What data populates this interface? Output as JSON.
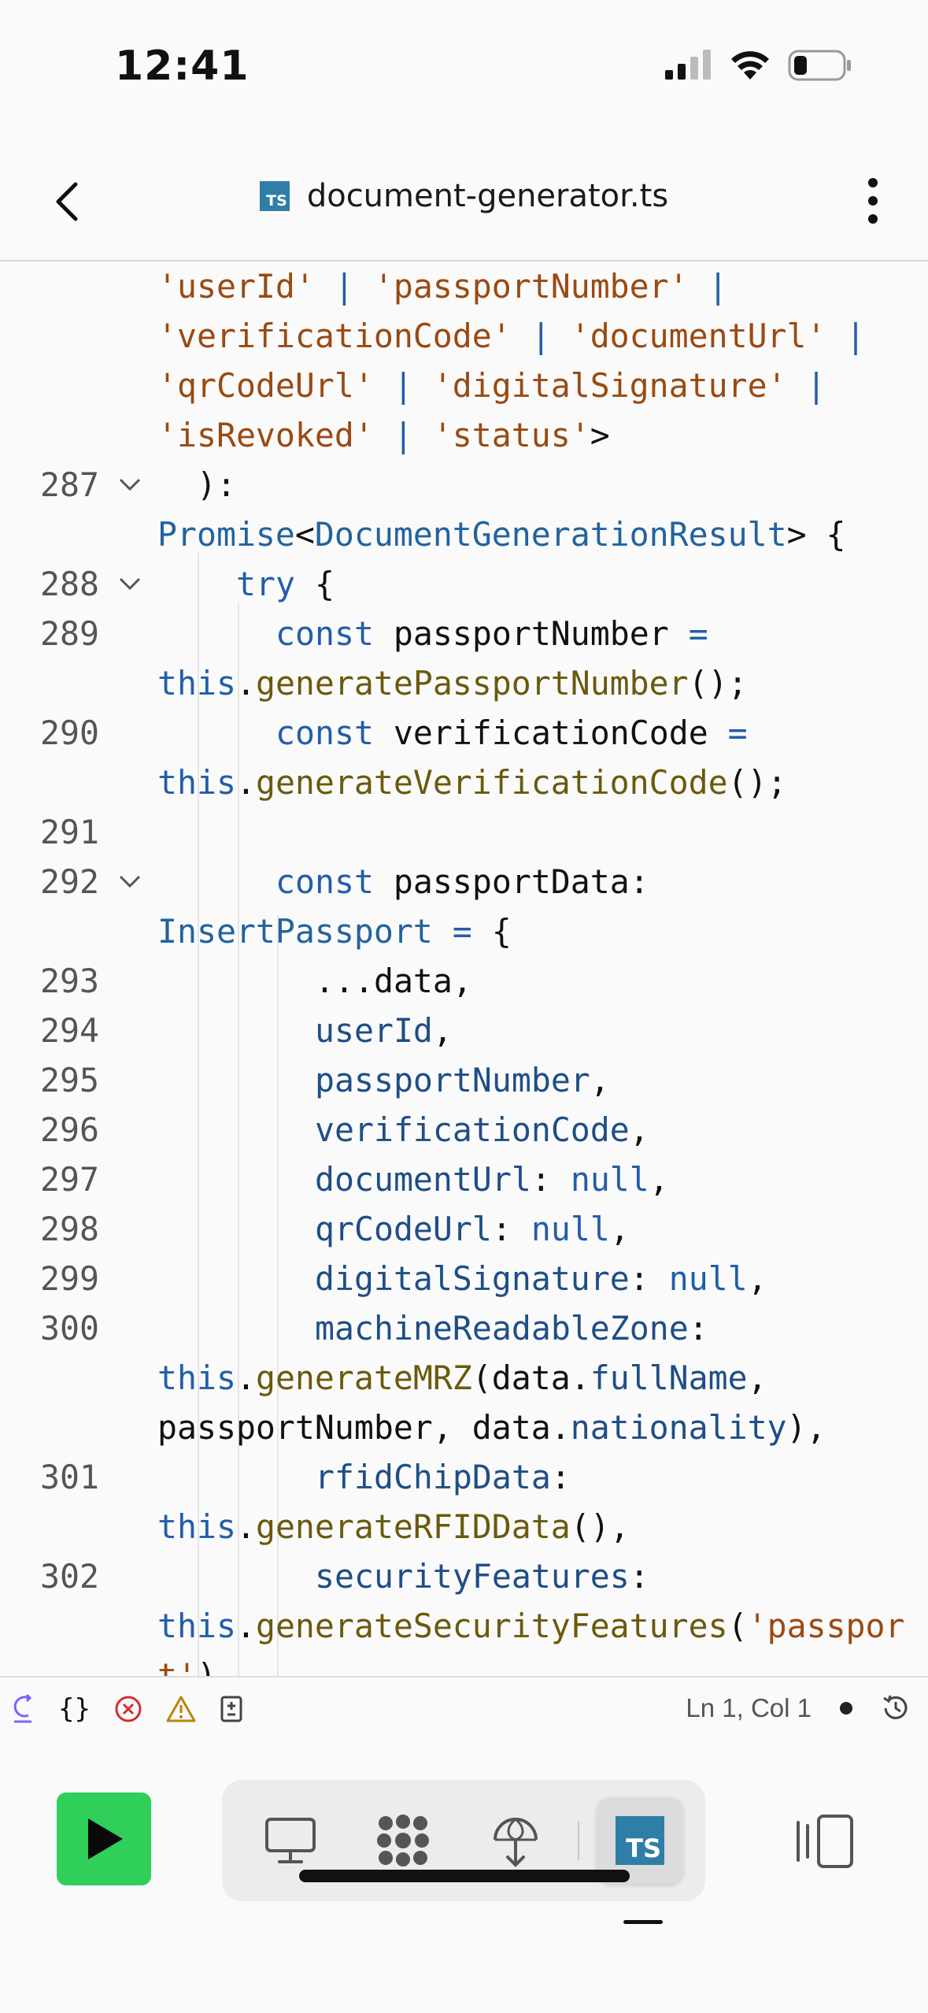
{
  "status_bar": {
    "time": "12:41"
  },
  "app_bar": {
    "file_badge": "TS",
    "file_name": "document-generator.ts"
  },
  "editor": {
    "lines": [
      {
        "num": "",
        "fold": false,
        "indent": 0,
        "tokens": [
          [
            "'userId'",
            "str"
          ],
          [
            " | ",
            "kw"
          ],
          [
            "'passportNumber'",
            "str"
          ],
          [
            " |",
            "kw"
          ]
        ]
      },
      {
        "num": "",
        "fold": false,
        "indent": 0,
        "tokens": [
          [
            "'verificationCode'",
            "str"
          ],
          [
            " | ",
            "kw"
          ],
          [
            "'documentUrl'",
            "str"
          ],
          [
            " |",
            "kw"
          ]
        ]
      },
      {
        "num": "",
        "fold": false,
        "indent": 0,
        "tokens": [
          [
            "'qrCodeUrl'",
            "str"
          ],
          [
            " | ",
            "kw"
          ],
          [
            "'digitalSignature'",
            "str"
          ],
          [
            " |",
            "kw"
          ]
        ]
      },
      {
        "num": "",
        "fold": false,
        "indent": 0,
        "tokens": [
          [
            "'isRevoked'",
            "str"
          ],
          [
            " | ",
            "kw"
          ],
          [
            "'status'",
            "str"
          ],
          [
            ">",
            "pl"
          ]
        ]
      },
      {
        "num": "287",
        "fold": true,
        "indent": 1,
        "tokens": [
          [
            "):",
            "pl"
          ]
        ]
      },
      {
        "num": "",
        "fold": false,
        "indent": 0,
        "tokens": [
          [
            "Promise",
            "ty"
          ],
          [
            "<",
            "pl"
          ],
          [
            "DocumentGenerationResult",
            "ty"
          ],
          [
            "> {",
            "pl"
          ]
        ]
      },
      {
        "num": "288",
        "fold": true,
        "indent": 2,
        "tokens": [
          [
            "try",
            "kw"
          ],
          [
            " {",
            "pl"
          ]
        ]
      },
      {
        "num": "289",
        "fold": false,
        "indent": 3,
        "tokens": [
          [
            "const",
            "kw"
          ],
          [
            " passportNumber ",
            "pl"
          ],
          [
            "=",
            "kw"
          ]
        ]
      },
      {
        "num": "",
        "fold": false,
        "indent": 0,
        "tokens": [
          [
            "this",
            "kw"
          ],
          [
            ".",
            "pl"
          ],
          [
            "generatePassportNumber",
            "fn"
          ],
          [
            "();",
            "pl"
          ]
        ]
      },
      {
        "num": "290",
        "fold": false,
        "indent": 3,
        "tokens": [
          [
            "const",
            "kw"
          ],
          [
            " verificationCode ",
            "pl"
          ],
          [
            "=",
            "kw"
          ]
        ]
      },
      {
        "num": "",
        "fold": false,
        "indent": 0,
        "tokens": [
          [
            "this",
            "kw"
          ],
          [
            ".",
            "pl"
          ],
          [
            "generateVerificationCode",
            "fn"
          ],
          [
            "();",
            "pl"
          ]
        ]
      },
      {
        "num": "291",
        "fold": false,
        "indent": 0,
        "tokens": []
      },
      {
        "num": "292",
        "fold": true,
        "indent": 3,
        "tokens": [
          [
            "const",
            "kw"
          ],
          [
            " passportData:",
            "pl"
          ]
        ]
      },
      {
        "num": "",
        "fold": false,
        "indent": 0,
        "tokens": [
          [
            "InsertPassport",
            "ty"
          ],
          [
            " = ",
            "kw"
          ],
          [
            "{",
            "pl"
          ]
        ]
      },
      {
        "num": "293",
        "fold": false,
        "indent": 4,
        "tokens": [
          [
            "...data,",
            "pl"
          ]
        ]
      },
      {
        "num": "294",
        "fold": false,
        "indent": 4,
        "tokens": [
          [
            "userId",
            "prop"
          ],
          [
            ",",
            "pl"
          ]
        ]
      },
      {
        "num": "295",
        "fold": false,
        "indent": 4,
        "tokens": [
          [
            "passportNumber",
            "prop"
          ],
          [
            ",",
            "pl"
          ]
        ]
      },
      {
        "num": "296",
        "fold": false,
        "indent": 4,
        "tokens": [
          [
            "verificationCode",
            "prop"
          ],
          [
            ",",
            "pl"
          ]
        ]
      },
      {
        "num": "297",
        "fold": false,
        "indent": 4,
        "tokens": [
          [
            "documentUrl",
            "prop"
          ],
          [
            ": ",
            "pl"
          ],
          [
            "null",
            "kw"
          ],
          [
            ",",
            "pl"
          ]
        ]
      },
      {
        "num": "298",
        "fold": false,
        "indent": 4,
        "tokens": [
          [
            "qrCodeUrl",
            "prop"
          ],
          [
            ": ",
            "pl"
          ],
          [
            "null",
            "kw"
          ],
          [
            ",",
            "pl"
          ]
        ]
      },
      {
        "num": "299",
        "fold": false,
        "indent": 4,
        "tokens": [
          [
            "digitalSignature",
            "prop"
          ],
          [
            ": ",
            "pl"
          ],
          [
            "null",
            "kw"
          ],
          [
            ",",
            "pl"
          ]
        ]
      },
      {
        "num": "300",
        "fold": false,
        "indent": 4,
        "tokens": [
          [
            "machineReadableZone",
            "prop"
          ],
          [
            ":",
            "pl"
          ]
        ]
      },
      {
        "num": "",
        "fold": false,
        "indent": 0,
        "tokens": [
          [
            "this",
            "kw"
          ],
          [
            ".",
            "pl"
          ],
          [
            "generateMRZ",
            "fn"
          ],
          [
            "(data",
            "pl"
          ],
          [
            ".",
            "pl"
          ],
          [
            "fullName",
            "prop"
          ],
          [
            ",",
            "pl"
          ]
        ]
      },
      {
        "num": "",
        "fold": false,
        "indent": 0,
        "tokens": [
          [
            "passportNumber, data",
            "pl"
          ],
          [
            ".",
            "pl"
          ],
          [
            "nationality",
            "prop"
          ],
          [
            "),",
            "pl"
          ]
        ]
      },
      {
        "num": "301",
        "fold": false,
        "indent": 4,
        "tokens": [
          [
            "rfidChipData",
            "prop"
          ],
          [
            ":",
            "pl"
          ]
        ]
      },
      {
        "num": "",
        "fold": false,
        "indent": 0,
        "tokens": [
          [
            "this",
            "kw"
          ],
          [
            ".",
            "pl"
          ],
          [
            "generateRFIDData",
            "fn"
          ],
          [
            "(),",
            "pl"
          ]
        ]
      },
      {
        "num": "302",
        "fold": false,
        "indent": 4,
        "tokens": [
          [
            "securityFeatures",
            "prop"
          ],
          [
            ":",
            "pl"
          ]
        ]
      },
      {
        "num": "",
        "fold": false,
        "indent": 0,
        "tokens": [
          [
            "this",
            "kw"
          ],
          [
            ".",
            "pl"
          ],
          [
            "generateSecurityFeatures",
            "fn"
          ],
          [
            "(",
            "pl"
          ],
          [
            "'passpor",
            "str"
          ]
        ]
      },
      {
        "num": "",
        "fold": false,
        "indent": 0,
        "tokens": [
          [
            "t'",
            "str"
          ],
          [
            "),",
            "pl"
          ]
        ]
      }
    ]
  },
  "toolbar": {
    "cursor_position": "Ln 1, Col 1",
    "icons": [
      "ai-assist-icon",
      "braces-icon",
      "error-icon",
      "warning-icon",
      "diff-icon"
    ],
    "status_dot": "unsaved-dot-icon",
    "history": "history-icon"
  },
  "bottom_nav": {
    "run": "play-icon",
    "tabs": [
      "desktop-icon",
      "apps-icon",
      "deploy-icon",
      "typescript-file-icon"
    ],
    "active_tab_badge": "TS",
    "panel": "panel-toggle-icon"
  },
  "colors": {
    "keyword": "#225ea8",
    "string": "#9a4a12",
    "function": "#6a5a0e",
    "property": "#1f4e86",
    "run_button": "#2fcf5a",
    "ts_badge": "#2f7ea8"
  }
}
